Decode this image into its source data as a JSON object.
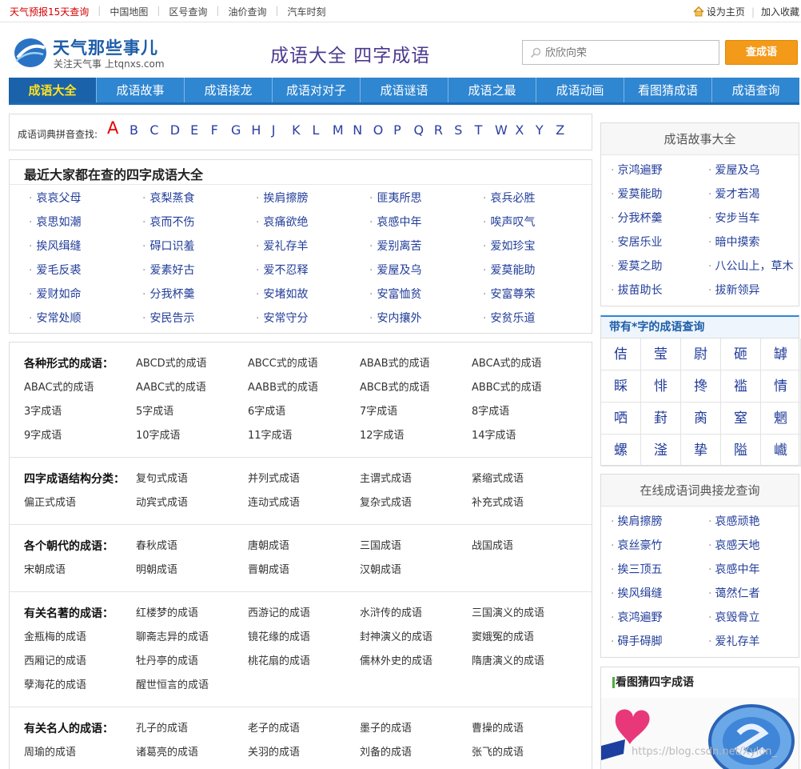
{
  "topbar": {
    "left_links": [
      "天气预报15天查询",
      "中国地图",
      "区号查询",
      "油价查询",
      "汽车时刻"
    ],
    "set_home": "设为主页",
    "add_favorite": "加入收藏"
  },
  "header": {
    "brand": "天气那些事儿",
    "slogan": "关注天气事 上tqnxs.com",
    "site_heading": "成语大全  四字成语",
    "search_placeholder": "欣欣向荣",
    "search_button": "查成语"
  },
  "nav": [
    "成语大全",
    "成语故事",
    "成语接龙",
    "成语对对子",
    "成语谜语",
    "成语之最",
    "成语动画",
    "看图猜成语",
    "成语查询"
  ],
  "pinyin": {
    "label": "成语词典拼音查找:",
    "letters": [
      "A",
      "B",
      "C",
      "D",
      "E",
      "F",
      "G",
      "H",
      "J",
      "K",
      "L",
      "M",
      "N",
      "O",
      "P",
      "Q",
      "R",
      "S",
      "T",
      "W",
      "X",
      "Y",
      "Z"
    ]
  },
  "recent": {
    "title": "最近大家都在查的四字成语大全",
    "idioms": [
      "哀哀父母",
      "哀梨蒸食",
      "挨肩擦膀",
      "匪夷所思",
      "哀兵必胜",
      "哀思如潮",
      "哀而不伤",
      "哀痛欲绝",
      "哀感中年",
      "唉声叹气",
      "挨风缉缝",
      "碍口识羞",
      "爱礼存羊",
      "爱别离苦",
      "爱如珍宝",
      "爱毛反裘",
      "爱素好古",
      "爱不忍释",
      "爱屋及乌",
      "爱莫能助",
      "爱财如命",
      "分我杯羹",
      "安堵如故",
      "安富恤贫",
      "安富尊荣",
      "安常处顺",
      "安民告示",
      "安常守分",
      "安内攘外",
      "安贫乐道"
    ]
  },
  "categories": [
    {
      "head": "各种形式的成语：",
      "items": [
        "ABCD式的成语",
        "ABCC式的成语",
        "ABAB式的成语",
        "ABCA式的成语",
        "ABAC式的成语",
        "AABC式的成语",
        "AABB式的成语",
        "ABCB式的成语",
        "ABBC式的成语",
        "3字成语",
        "5字成语",
        "6字成语",
        "7字成语",
        "8字成语",
        "9字成语",
        "10字成语",
        "11字成语",
        "12字成语",
        "14字成语"
      ]
    },
    {
      "head": "四字成语结构分类：",
      "items": [
        "复句式成语",
        "并列式成语",
        "主谓式成语",
        "紧缩式成语",
        "偏正式成语",
        "动宾式成语",
        "连动式成语",
        "复杂式成语",
        "补充式成语"
      ]
    },
    {
      "head": "各个朝代的成语：",
      "items": [
        "春秋成语",
        "唐朝成语",
        "三国成语",
        "战国成语",
        "宋朝成语",
        "明朝成语",
        "晋朝成语",
        "汉朝成语"
      ]
    },
    {
      "head": "有关名著的成语：",
      "items": [
        "红楼梦的成语",
        "西游记的成语",
        "水浒传的成语",
        "三国演义的成语",
        "金瓶梅的成语",
        "聊斋志异的成语",
        "镜花缘的成语",
        "封神演义的成语",
        "窦娥冤的成语",
        "西厢记的成语",
        "牡丹亭的成语",
        "桃花扇的成语",
        "儒林外史的成语",
        "隋唐演义的成语",
        "孽海花的成语",
        "醒世恒言的成语"
      ]
    },
    {
      "head": "有关名人的成语：",
      "items": [
        "孔子的成语",
        "老子的成语",
        "墨子的成语",
        "曹操的成语",
        "周瑜的成语",
        "诸葛亮的成语",
        "关羽的成语",
        "刘备的成语",
        "张飞的成语"
      ]
    }
  ],
  "side_stories": {
    "title": "成语故事大全",
    "items": [
      "京鸿遍野",
      "爱屋及乌",
      "爱莫能助",
      "爱才若渴",
      "分我杯羹",
      "安步当车",
      "安居乐业",
      "暗中摸索",
      "爱莫之助",
      "八公山上，草木",
      "拔苗助长",
      "拔新领异"
    ]
  },
  "side_chars": {
    "title": "带有*字的成语查询",
    "chars": [
      "佶",
      "莹",
      "尉",
      "砸",
      "罅",
      "睬",
      "悱",
      "搀",
      "褴",
      "情",
      "哂",
      "葑",
      "脔",
      "窒",
      "魍",
      "螺",
      "滏",
      "挚",
      "隘",
      "巇"
    ]
  },
  "side_jielong": {
    "title": "在线成语词典接龙查询",
    "items": [
      "挨肩擦膀",
      "哀感顽艳",
      "哀丝豪竹",
      "哀感天地",
      "挨三顶五",
      "哀感中年",
      "挨风缉缝",
      "蔼然仁者",
      "哀鸿遍野",
      "哀毁骨立",
      "碍手碍脚",
      "爱礼存羊"
    ]
  },
  "side_guess": {
    "title": "看图猜四字成语"
  },
  "watermark": "https://blog.csdn.net/Xylon_"
}
